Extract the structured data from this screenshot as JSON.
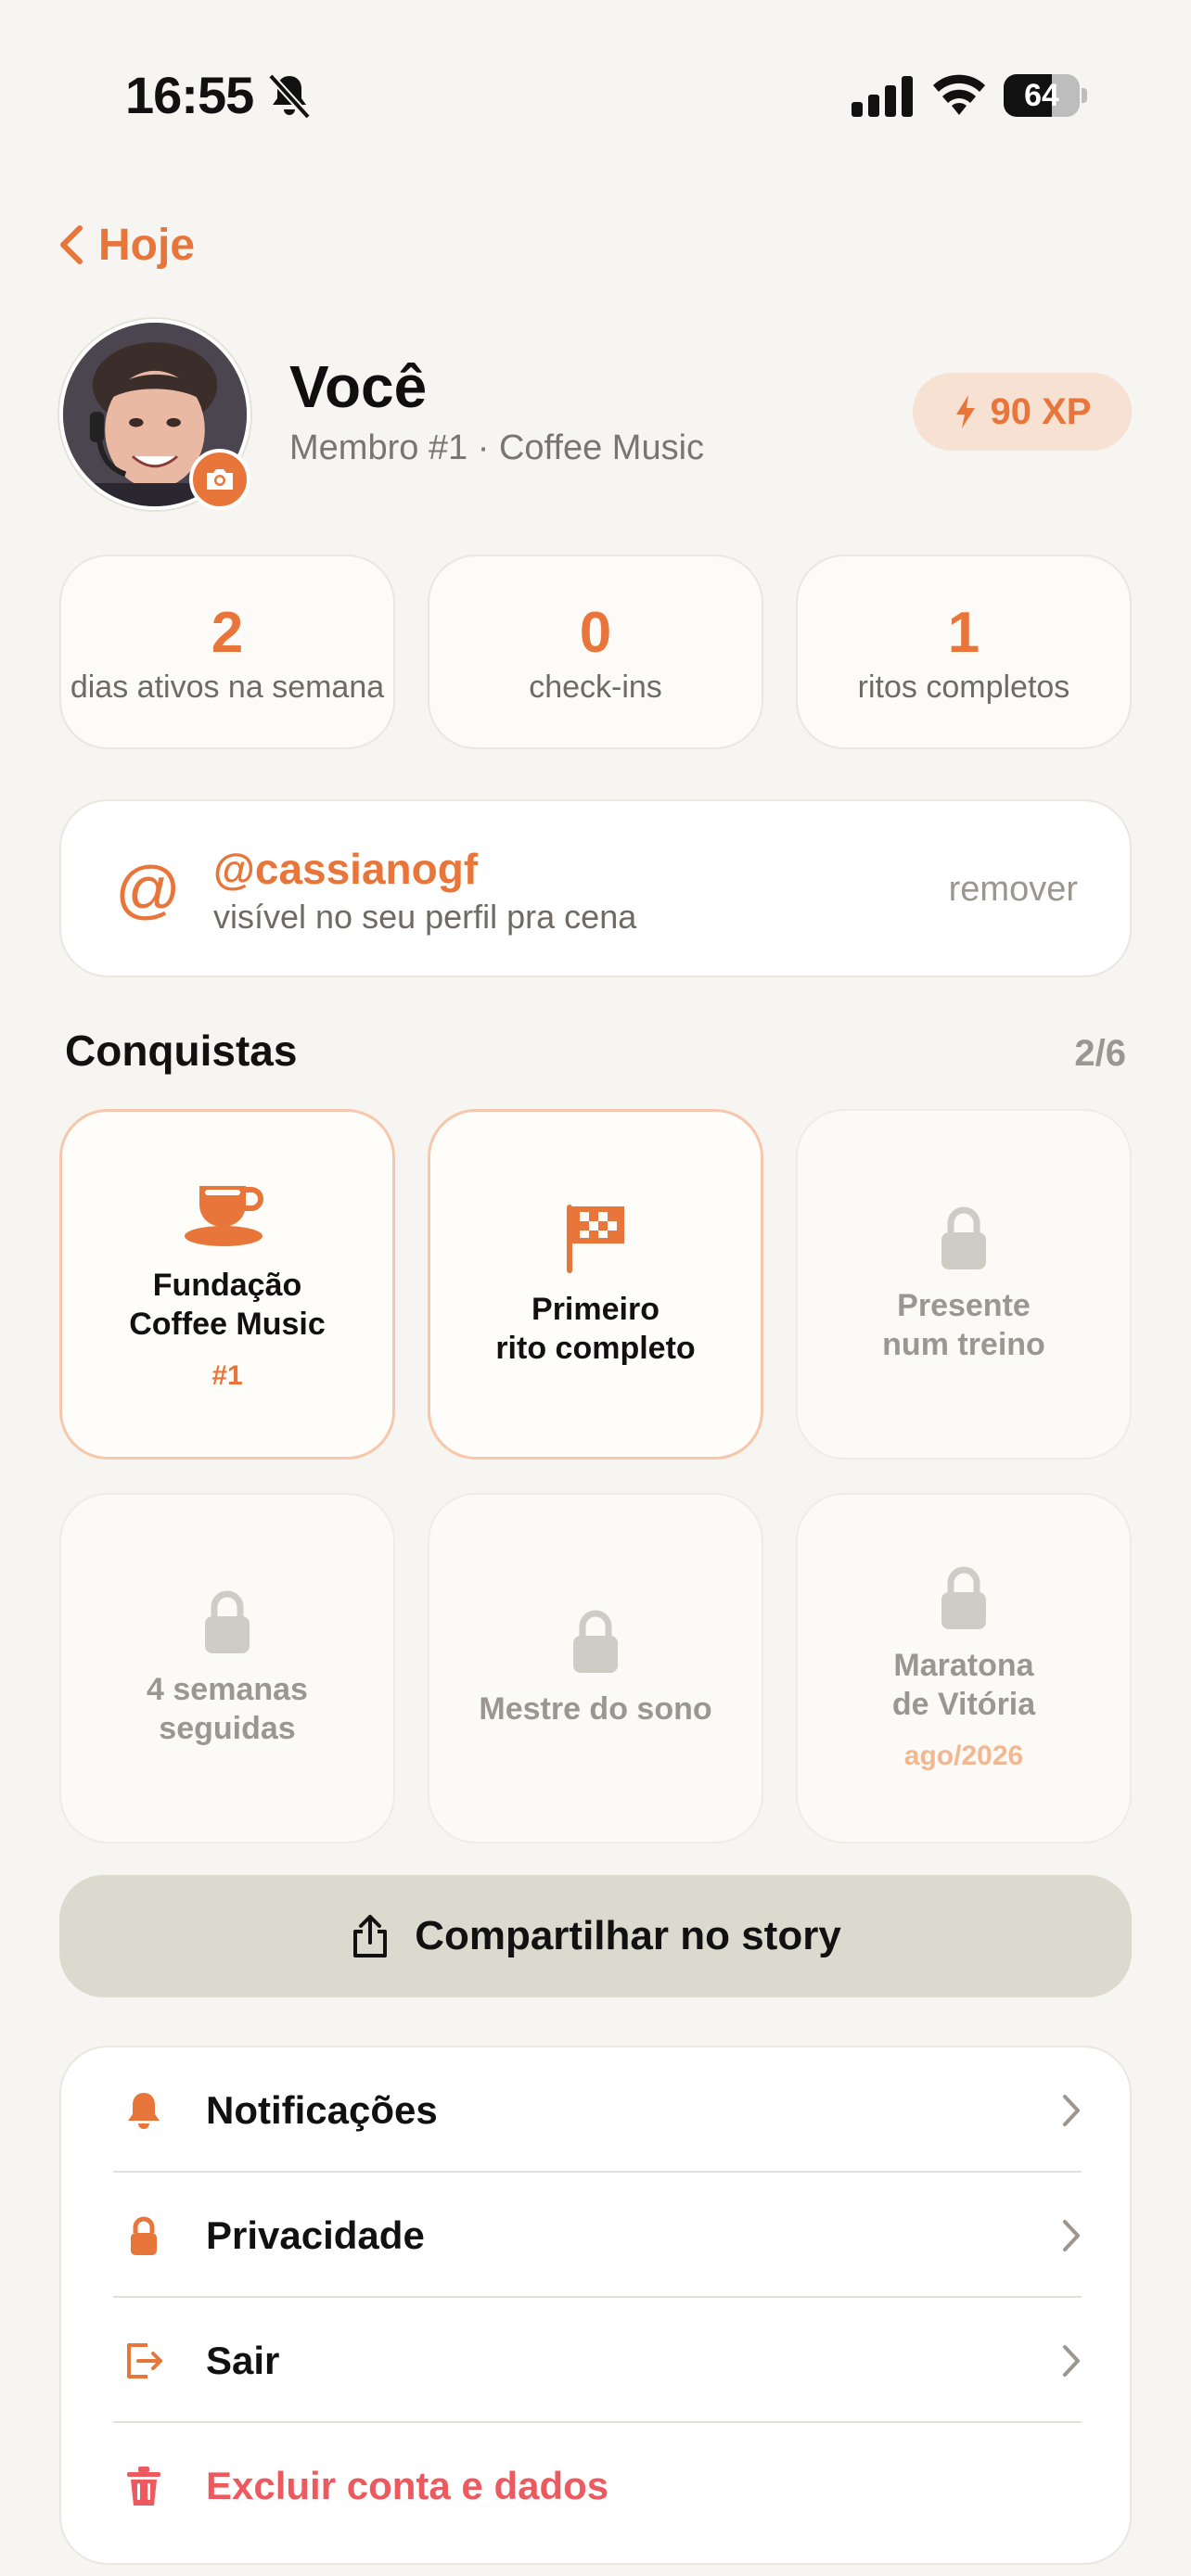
{
  "status_bar": {
    "time": "16:55",
    "battery": "64",
    "battery_level": 0.64,
    "icons": [
      "bell-slash-icon",
      "signal-icon",
      "wifi-icon",
      "battery-icon"
    ]
  },
  "nav": {
    "back_label": "Hoje"
  },
  "profile": {
    "name": "Você",
    "subtitle": "Membro #1 · Coffee Music",
    "xp": "90 XP"
  },
  "stats": [
    {
      "value": "2",
      "label": "dias ativos na semana"
    },
    {
      "value": "0",
      "label": "check-ins"
    },
    {
      "value": "1",
      "label": "ritos completos"
    }
  ],
  "handle": {
    "symbol": "@",
    "name": "@cassianogf",
    "description": "visível no seu perfil pra cena",
    "remove_label": "remover"
  },
  "achievements": {
    "title": "Conquistas",
    "count": "2/6",
    "items": [
      {
        "label": "Fundação\nCoffee Music",
        "extra": "#1",
        "status": "unlocked",
        "icon": "coffee-cup-icon"
      },
      {
        "label": "Primeiro\nrito completo",
        "extra": "",
        "status": "unlocked",
        "icon": "checkered-flag-icon"
      },
      {
        "label": "Presente\nnum treino",
        "extra": "",
        "status": "locked",
        "icon": "lock-icon"
      },
      {
        "label": "4 semanas\nseguidas",
        "extra": "",
        "status": "locked",
        "icon": "lock-icon"
      },
      {
        "label": "Mestre do sono",
        "extra": "",
        "status": "locked",
        "icon": "lock-icon"
      },
      {
        "label": "Maratona\nde Vitória",
        "extra": "ago/2026",
        "status": "locked",
        "icon": "lock-icon"
      }
    ]
  },
  "share": {
    "label": "Compartilhar no story"
  },
  "settings": [
    {
      "label": "Notificações",
      "icon": "bell-icon",
      "danger": false
    },
    {
      "label": "Privacidade",
      "icon": "lock-icon",
      "danger": false
    },
    {
      "label": "Sair",
      "icon": "logout-icon",
      "danger": false
    },
    {
      "label": "Excluir conta e dados",
      "icon": "trash-icon",
      "danger": true
    }
  ],
  "colors": {
    "accent": "#e8763a",
    "danger": "#ec5a60",
    "background": "#f6f5f1",
    "muted": "#9b968f"
  }
}
